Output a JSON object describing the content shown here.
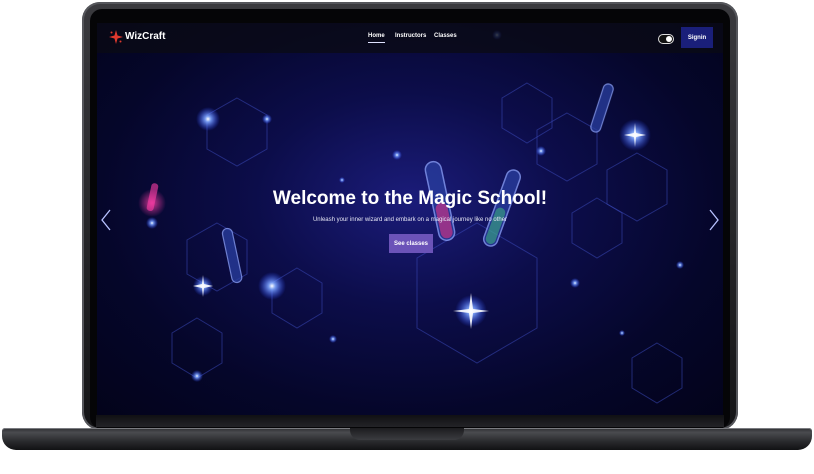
{
  "brand": {
    "name": "WizCraft",
    "accent": "#e0392e"
  },
  "nav": {
    "items": [
      {
        "label": "Home",
        "active": true
      },
      {
        "label": "Instructors"
      },
      {
        "label": "Classes"
      }
    ]
  },
  "theme_toggle": {
    "state": "dark",
    "icon": "toggle-switch"
  },
  "signin": {
    "label": "Signin",
    "color": "#1a1f7a"
  },
  "hero": {
    "title": "Welcome to the Magic School!",
    "subtitle": "Unleash your inner wizard and embark on a magical journey like no other",
    "cta_label": "See classes",
    "cta_color": "#6b53b8"
  },
  "carousel": {
    "prev_icon": "chevron-left-icon",
    "next_icon": "chevron-right-icon"
  },
  "colors": {
    "background": "#0c0d4a",
    "glow": "#4f7dff"
  }
}
